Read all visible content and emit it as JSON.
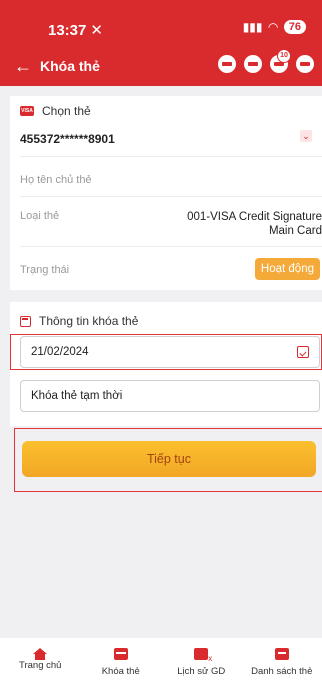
{
  "status_bar": {
    "time": "13:37",
    "battery": "76"
  },
  "header": {
    "title": "Khóa thẻ",
    "notification_count": "10"
  },
  "card_section": {
    "label": "Chọn thẻ",
    "card_number": "455372******8901",
    "holder_label": "Họ tên chủ thẻ",
    "type_label": "Loại thẻ",
    "type_value_line1": "001-VISA Credit Signature",
    "type_value_line2": "Main Card",
    "status_label": "Trạng thái",
    "status_value": "Hoạt động"
  },
  "lock_section": {
    "label": "Thông tin khóa thẻ",
    "date_value": "21/02/2024",
    "lock_type_value": "Khóa thẻ tạm thời"
  },
  "actions": {
    "continue_label": "Tiếp tục"
  },
  "bottom_nav": {
    "items": [
      {
        "label": "Trang chủ",
        "icon": "home-icon"
      },
      {
        "label": "Khóa thẻ",
        "icon": "card-lock-icon"
      },
      {
        "label": "Lịch sử GD",
        "icon": "transaction-history-icon"
      },
      {
        "label": "Danh sách thẻ",
        "icon": "card-list-icon"
      }
    ]
  },
  "colors": {
    "brand_red": "#d92a2e",
    "button_yellow": "#fbc02d",
    "status_orange": "#f5a938"
  }
}
